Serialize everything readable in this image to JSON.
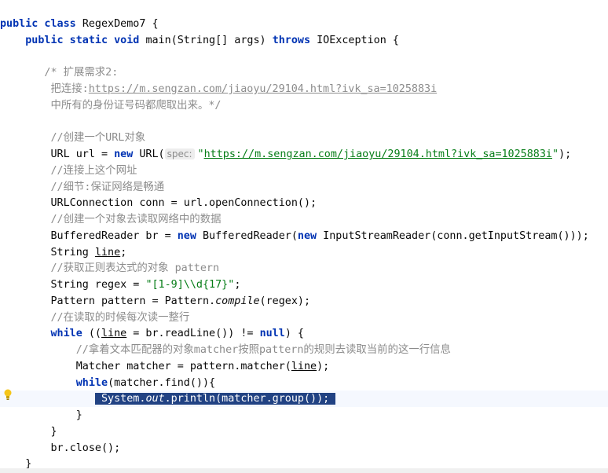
{
  "editor": {
    "lines": [
      {
        "segments": [
          {
            "t": "public class ",
            "c": "kw"
          },
          {
            "t": "RegexDemo7 {"
          }
        ]
      },
      {
        "segments": [
          {
            "t": "    public static void ",
            "c": "kw"
          },
          {
            "t": "main(String[] args) "
          },
          {
            "t": "throws ",
            "c": "kw"
          },
          {
            "t": "IOException {"
          }
        ]
      },
      {
        "segments": []
      },
      {
        "segments": [
          {
            "t": "       /* 扩展需求2:",
            "c": "cm"
          }
        ]
      },
      {
        "segments": [
          {
            "t": "        把连接:",
            "c": "cm"
          },
          {
            "t": "https://m.sengzan.com/jiaoyu/29104.html?ivk_sa=1025883i",
            "c": "cmlink"
          }
        ]
      },
      {
        "segments": [
          {
            "t": "        中所有的身份证号码都爬取出来。*/",
            "c": "cm"
          }
        ]
      },
      {
        "segments": []
      },
      {
        "segments": [
          {
            "t": "        //创建一个URL对象",
            "c": "cm"
          }
        ]
      },
      {
        "segments": [
          {
            "t": "        URL url = "
          },
          {
            "t": "new ",
            "c": "kw"
          },
          {
            "t": "URL("
          },
          {
            "t": "spec:",
            "c": "hint"
          },
          {
            "t": "\"",
            "c": "str"
          },
          {
            "t": "https://m.sengzan.com/jiaoyu/29104.html?ivk_sa=1025883i",
            "c": "link"
          },
          {
            "t": "\"",
            "c": "str"
          },
          {
            "t": ");"
          }
        ]
      },
      {
        "segments": [
          {
            "t": "        //连接上这个网址",
            "c": "cm"
          }
        ]
      },
      {
        "segments": [
          {
            "t": "        //细节:保证网络是畅通",
            "c": "cm"
          }
        ]
      },
      {
        "segments": [
          {
            "t": "        URLConnection conn = url.openConnection();"
          }
        ]
      },
      {
        "segments": [
          {
            "t": "        //创建一个对象去读取网络中的数据",
            "c": "cm"
          }
        ]
      },
      {
        "segments": [
          {
            "t": "        BufferedReader br = "
          },
          {
            "t": "new ",
            "c": "kw"
          },
          {
            "t": "BufferedReader("
          },
          {
            "t": "new ",
            "c": "kw"
          },
          {
            "t": "InputStreamReader(conn.getInputStream()));"
          }
        ]
      },
      {
        "segments": [
          {
            "t": "        String "
          },
          {
            "t": "line",
            "c": "ul"
          },
          {
            "t": ";"
          }
        ]
      },
      {
        "segments": [
          {
            "t": "        //获取正则表达式的对象 pattern",
            "c": "cm"
          }
        ]
      },
      {
        "segments": [
          {
            "t": "        String regex = "
          },
          {
            "t": "\"[1-9]\\\\d{17}\"",
            "c": "str"
          },
          {
            "t": ";"
          }
        ]
      },
      {
        "segments": [
          {
            "t": "        Pattern pattern = Pattern."
          },
          {
            "t": "compile",
            "c": "it"
          },
          {
            "t": "(regex);"
          }
        ]
      },
      {
        "segments": [
          {
            "t": "        //在读取的时候每次读一整行",
            "c": "cm"
          }
        ]
      },
      {
        "segments": [
          {
            "t": "        "
          },
          {
            "t": "while ",
            "c": "kw"
          },
          {
            "t": "(("
          },
          {
            "t": "line",
            "c": "ul"
          },
          {
            "t": " = br.readLine()) != "
          },
          {
            "t": "null",
            "c": "kw"
          },
          {
            "t": ") {"
          }
        ]
      },
      {
        "segments": [
          {
            "t": "            //拿着文本匹配器的对象matcher按照pattern的规则去读取当前的这一行信息",
            "c": "cm"
          }
        ]
      },
      {
        "segments": [
          {
            "t": "            Matcher matcher = pattern.matcher("
          },
          {
            "t": "line",
            "c": "ul"
          },
          {
            "t": ");"
          }
        ]
      },
      {
        "segments": [
          {
            "t": "            "
          },
          {
            "t": "while",
            "c": "kw"
          },
          {
            "t": "(matcher.find()){"
          }
        ]
      },
      {
        "segments": [
          {
            "t": "               "
          },
          {
            "t": " System.",
            "c": "sel"
          },
          {
            "t": "out",
            "c": "sel it"
          },
          {
            "t": ".println(matcher.group()); ",
            "c": "sel"
          }
        ],
        "current": true
      },
      {
        "segments": [
          {
            "t": "            }"
          }
        ]
      },
      {
        "segments": [
          {
            "t": "        }"
          }
        ]
      },
      {
        "segments": [
          {
            "t": "        br.close();"
          }
        ]
      },
      {
        "segments": [
          {
            "t": "    }"
          }
        ]
      }
    ]
  },
  "gutter": {
    "bulb_icon": "lightbulb-icon",
    "bulb_color": "#f5c518"
  }
}
